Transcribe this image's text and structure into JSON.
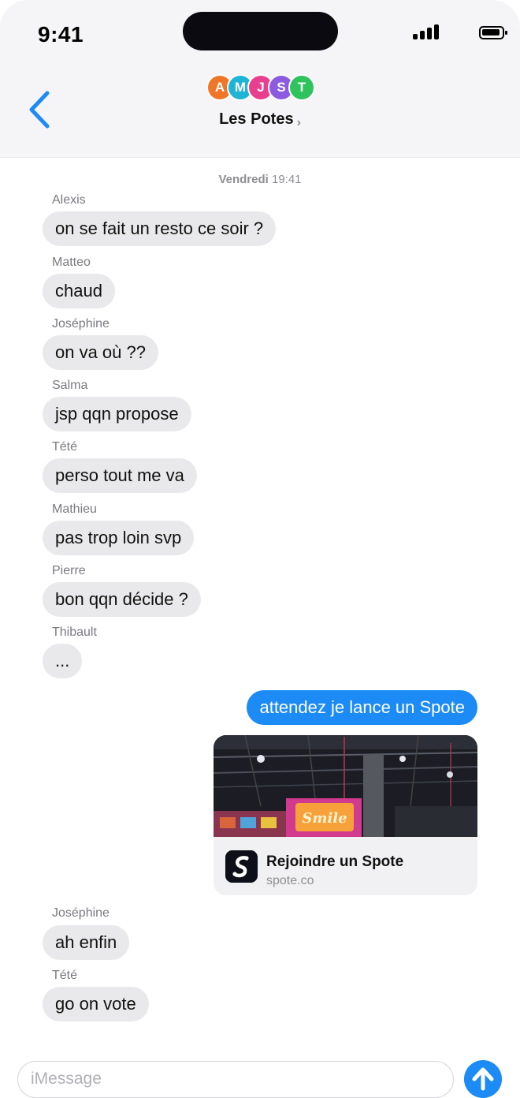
{
  "status_bar": {
    "time": "9:41"
  },
  "header": {
    "group_name": "Les Potes",
    "chevron": "›",
    "avatars": [
      {
        "initial": "A",
        "color": "#f0772a"
      },
      {
        "initial": "M",
        "color": "#1fb4d6"
      },
      {
        "initial": "J",
        "color": "#e93f8f"
      },
      {
        "initial": "S",
        "color": "#8d5be0"
      },
      {
        "initial": "T",
        "color": "#2fc35e"
      }
    ]
  },
  "timestamp": {
    "day": "Vendredi",
    "time": "19:41"
  },
  "messages": [
    {
      "sender": "Alexis",
      "text": "on se fait un resto ce soir ?"
    },
    {
      "sender": "Matteo",
      "text": "chaud"
    },
    {
      "sender": "Joséphine",
      "text": "on va où ??"
    },
    {
      "sender": "Salma",
      "text": "jsp qqn propose"
    },
    {
      "sender": "Tété",
      "text": "perso tout me va"
    },
    {
      "sender": "Mathieu",
      "text": "pas trop loin svp"
    },
    {
      "sender": "Pierre",
      "text": "bon qqn décide ?"
    },
    {
      "sender": "Thibault",
      "text": "..."
    },
    {
      "sender": "",
      "text": "attendez je lance un Spote",
      "outgoing": true
    },
    {
      "sender": "Joséphine",
      "text": "ah enfin"
    },
    {
      "sender": "Tété",
      "text": "go on vote"
    }
  ],
  "link_card": {
    "title": "Rejoindre un Spote",
    "url": "spote.co",
    "image_sign_text": "Smile"
  },
  "composer": {
    "placeholder": "iMessage"
  },
  "colors": {
    "accent": "#1d8bf5",
    "incoming_bubble": "#e9e9eb"
  }
}
